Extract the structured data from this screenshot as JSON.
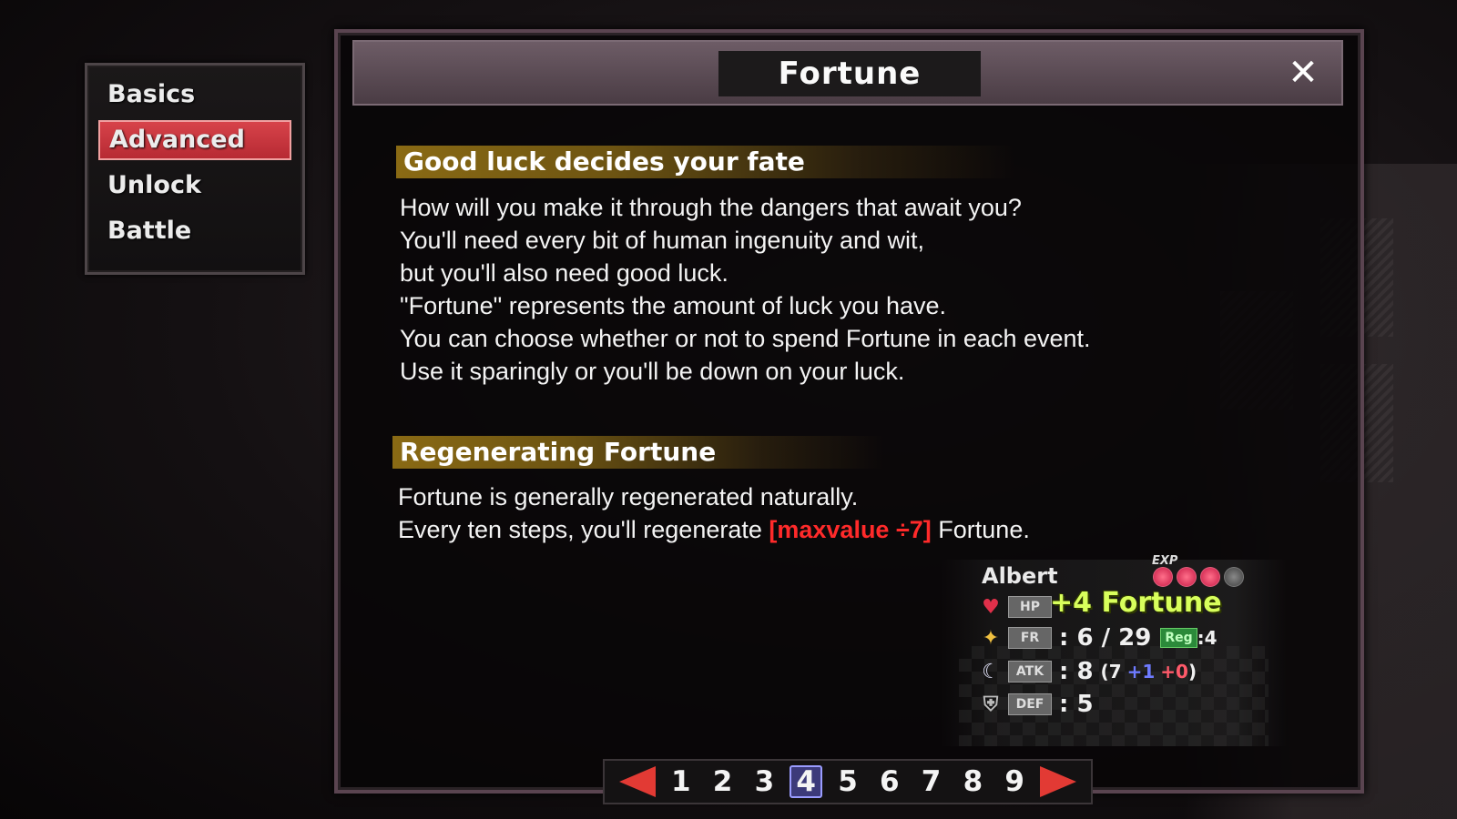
{
  "menu": {
    "items": [
      {
        "label": "Basics"
      },
      {
        "label": "Advanced"
      },
      {
        "label": "Unlock"
      },
      {
        "label": "Battle"
      }
    ],
    "active_index": 1
  },
  "panel": {
    "title": "Fortune",
    "close_icon": "close-icon",
    "sections": [
      {
        "heading": "Good luck decides your fate",
        "lines": [
          "How will you make it through the dangers that await you?",
          "You'll need every bit of human ingenuity and wit,",
          "but you'll also need good luck.",
          "\"Fortune\" represents the amount of luck you have.",
          "You can choose whether or not to spend Fortune in each event.",
          "Use it sparingly or you'll be down on your luck."
        ]
      },
      {
        "heading": "Regenerating Fortune",
        "lines": [
          "Fortune is generally regenerated naturally."
        ],
        "formula_line": {
          "prefix": "Every ten steps, you'll regenerate ",
          "highlight": "[maxvalue ÷7]",
          "suffix": " Fortune."
        }
      }
    ]
  },
  "stats_card": {
    "name": "Albert",
    "exp_label": "EXP",
    "exp_filled": 3,
    "exp_total": 4,
    "fortune_gain": "+4 Fortune",
    "rows": [
      {
        "icon": "heart-icon",
        "tag": "HP",
        "value": ""
      },
      {
        "icon": "star-icon",
        "tag": "FR",
        "value": ": 6 / 29",
        "reg_label": "Reg",
        "reg_value": ":4"
      },
      {
        "icon": "moon-icon",
        "tag": "ATK",
        "value": ": 8",
        "detail_open": "(7",
        "detail_blue": "+1",
        "detail_red": "+0",
        "detail_close": ")"
      },
      {
        "icon": "shield-icon",
        "tag": "DEF",
        "value": ": 5"
      }
    ]
  },
  "pager": {
    "pages": [
      "1",
      "2",
      "3",
      "4",
      "5",
      "6",
      "7",
      "8",
      "9"
    ],
    "current": "4",
    "prev_icon": "arrow-left-icon",
    "next_icon": "arrow-right-icon"
  },
  "colors": {
    "accent_red": "#d7434a",
    "heading_gold": "#8a6a14",
    "highlight_red": "#ff2a2a",
    "fortune_green": "#d8ff5c"
  }
}
